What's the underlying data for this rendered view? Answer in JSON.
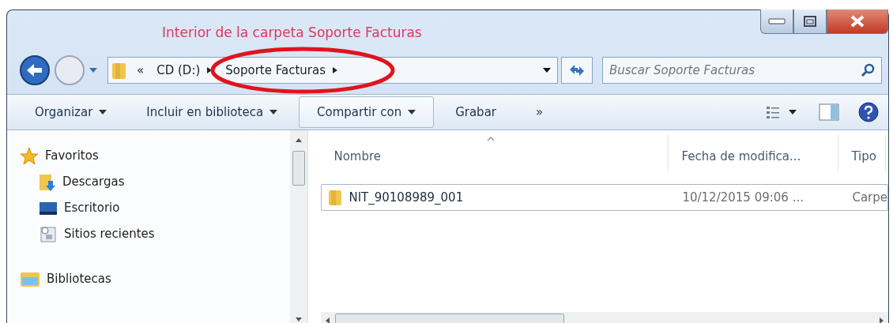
{
  "window": {
    "annotation": "Interior de la carpeta Soporte Facturas"
  },
  "address": {
    "overflow": "«",
    "crumbs": [
      {
        "label": "CD (D:)"
      },
      {
        "label": "Soporte Facturas",
        "circled": true
      }
    ]
  },
  "search": {
    "placeholder": "Buscar Soporte Facturas"
  },
  "toolbar": [
    {
      "label": "Organizar",
      "kind": "menu",
      "hover": false
    },
    {
      "label": "Incluir en biblioteca",
      "kind": "menu",
      "hover": false
    },
    {
      "label": "Compartir con",
      "kind": "menu",
      "hover": true
    },
    {
      "label": "Grabar",
      "kind": "plain",
      "hover": false
    },
    {
      "label": "»",
      "kind": "plain",
      "hover": false
    }
  ],
  "sidebar": {
    "items": [
      {
        "label": "Favoritos",
        "kind": "group"
      },
      {
        "label": "Descargas",
        "kind": "item"
      },
      {
        "label": "Escritorio",
        "kind": "item"
      },
      {
        "label": "Sitios recientes",
        "kind": "item"
      },
      {
        "label": "Bibliotecas",
        "kind": "group"
      }
    ]
  },
  "table": {
    "columns": [
      {
        "label": "Nombre",
        "sorted": true
      },
      {
        "label": "Fecha de modifica...",
        "sorted": false
      },
      {
        "label": "Tipo",
        "sorted": false
      }
    ],
    "rows": [
      {
        "name": "NIT_90108989_001",
        "date": "10/12/2015 09:06 ...",
        "type": "Carpe",
        "focused": true
      }
    ]
  }
}
